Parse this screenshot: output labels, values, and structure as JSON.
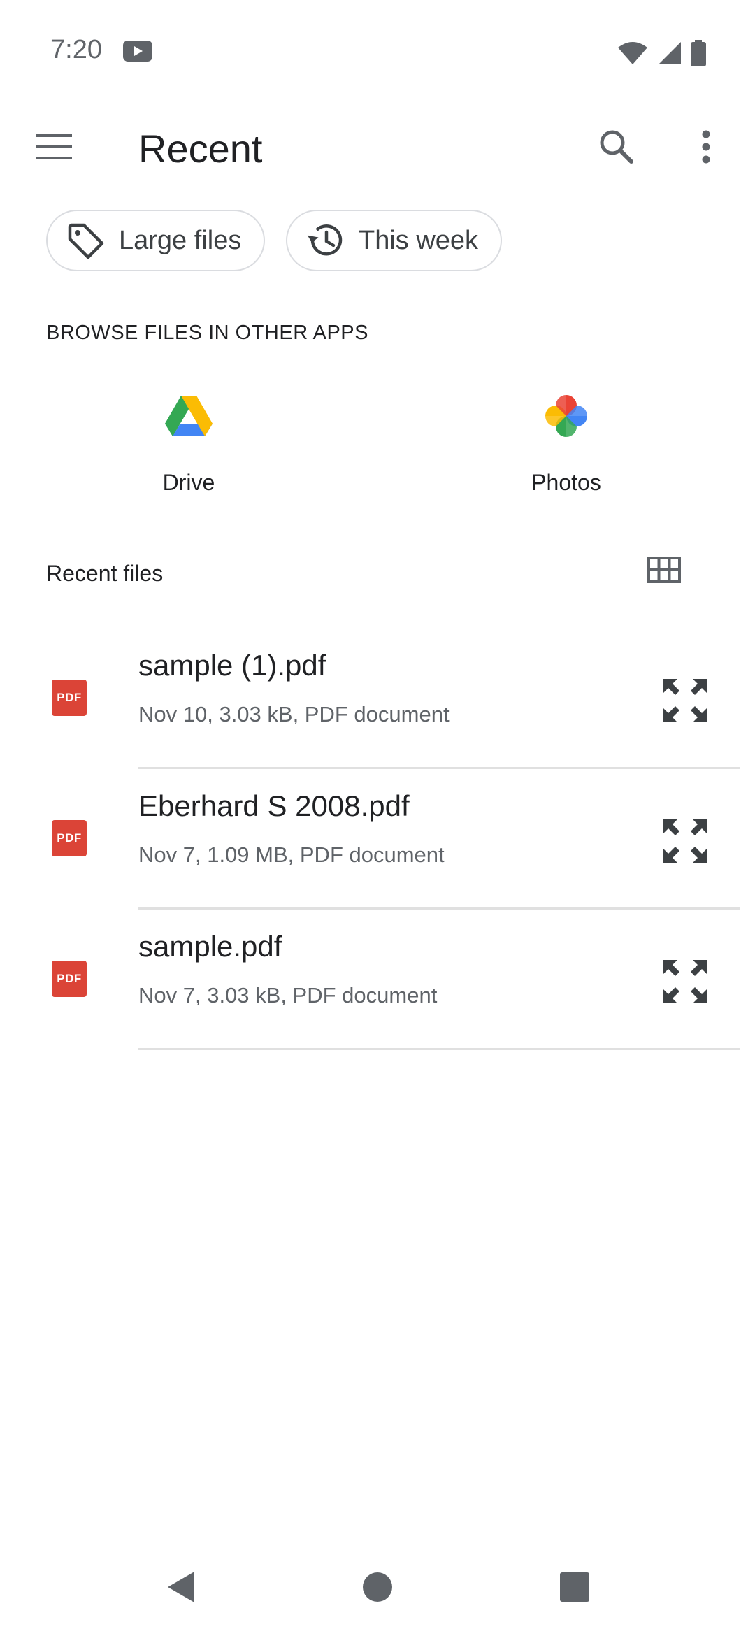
{
  "status_bar": {
    "time": "7:20"
  },
  "app_bar": {
    "title": "Recent"
  },
  "chips": [
    {
      "label": "Large files",
      "icon": "tag-icon"
    },
    {
      "label": "This week",
      "icon": "history-icon"
    }
  ],
  "browse": {
    "heading": "BROWSE FILES IN OTHER APPS",
    "apps": [
      {
        "label": "Drive",
        "icon": "google-drive-icon"
      },
      {
        "label": "Photos",
        "icon": "google-photos-icon"
      }
    ]
  },
  "recent": {
    "heading": "Recent files",
    "files": [
      {
        "name": "sample (1).pdf",
        "meta": "Nov 10, 3.03 kB, PDF document",
        "badge": "PDF"
      },
      {
        "name": "Eberhard S 2008.pdf",
        "meta": "Nov 7, 1.09 MB, PDF document",
        "badge": "PDF"
      },
      {
        "name": "sample.pdf",
        "meta": "Nov 7, 3.03 kB, PDF document",
        "badge": "PDF"
      }
    ]
  },
  "colors": {
    "pdf_red": "#db4437",
    "divider": "#e0e0e0",
    "secondary_text": "#5f6368"
  }
}
